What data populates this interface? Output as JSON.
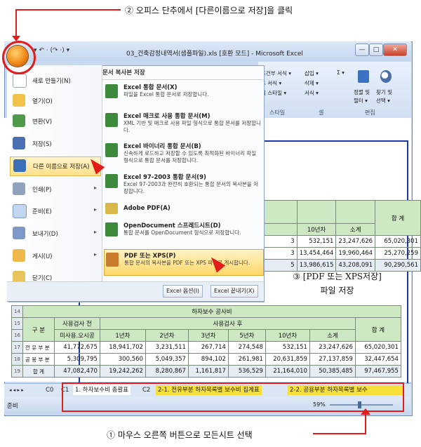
{
  "annotations": {
    "top": "② 오피스 단추에서 [다른이름으로 저장]을 클릭",
    "middle_line1": "③ [PDF 또는 XPS저장]",
    "middle_line2": "파일 저장",
    "bottom": "① 마우스 오른쪽 버튼으로 모든시트 선택"
  },
  "window": {
    "title": "03_건축감정내역서(샘플파일).xls [호환 모드] - Microsoft Excel",
    "qat": "▾ ↶ · (↷ ·) ▾",
    "controls": [
      "—",
      "□",
      "✕"
    ]
  },
  "ribbon": {
    "row1": [
      "조건부 서식 ▾",
      "삽입 ▾",
      "Σ ▾"
    ],
    "row2": [
      "표 서식 ▾",
      "삭제 ▾",
      "정렬 및",
      "찾기 및"
    ],
    "row3": [
      "셀 스타일 ▾",
      "서식 ▾",
      "필터 ▾",
      "선택 ▾"
    ],
    "groups": [
      "스타일",
      "셀",
      "편집"
    ]
  },
  "menu": {
    "items": [
      {
        "label": "새로 만들기(N)",
        "icon": "new-document-icon",
        "arrow": ""
      },
      {
        "label": "열기(O)",
        "icon": "open-folder-icon",
        "arrow": ""
      },
      {
        "label": "변환(V)",
        "icon": "convert-icon",
        "arrow": ""
      },
      {
        "label": "저장(S)",
        "icon": "save-disk-icon",
        "arrow": ""
      },
      {
        "label": "다른 이름으로 저장(A)",
        "icon": "save-as-icon",
        "arrow": "▸"
      },
      {
        "label": "인쇄(P)",
        "icon": "printer-icon",
        "arrow": "▸"
      },
      {
        "label": "준비(E)",
        "icon": "prepare-icon",
        "arrow": "▸"
      },
      {
        "label": "보내기(D)",
        "icon": "send-icon",
        "arrow": "▸"
      },
      {
        "label": "게시(U)",
        "icon": "publish-icon",
        "arrow": "▸"
      },
      {
        "label": "닫기(C)",
        "icon": "close-folder-icon",
        "arrow": ""
      }
    ],
    "sub_header": "문서 복사본 저장",
    "sub_options": [
      {
        "title": "Excel 통합 문서(X)",
        "desc": "파일을 Excel 통합 문서로 저장합니다."
      },
      {
        "title": "Excel 매크로 사용 통합 문서(M)",
        "desc": "XML 기반 및 매크로 사용 파일 형식으로 통합 문서를 저장합니다."
      },
      {
        "title": "Excel 바이너리 통합 문서(B)",
        "desc": "신속하게 로드하고 저장할 수 있도록 최적화된 바이너리 파일 형식으로 통합 문서를 저장합니다."
      },
      {
        "title": "Excel 97-2003 통합 문서(9)",
        "desc": "Excel 97-2003과 완전히 호환되는 통합 문서의 복사본을 저장합니다."
      },
      {
        "title": "Adobe PDF(A)",
        "desc": ""
      },
      {
        "title": "OpenDocument 스프레드시트(D)",
        "desc": "통합 문서를 OpenDocument 형식으로 저장합니다."
      },
      {
        "title": "PDF 또는 XPS(P)",
        "desc": "통합 문서의 복사본을 PDF 또는 XPS 파일로 게시합니다."
      }
    ],
    "options_button": "Excel 옵션(I)",
    "exit_button": "Excel 끝내기(X)"
  },
  "table_top": {
    "total_header": "합 계",
    "headers": [
      "10년차",
      "소계"
    ],
    "rows": [
      [
        "3",
        "532,151",
        "23,247,626",
        "65,020,301"
      ],
      [
        "3",
        "13,454,464",
        "19,960,464",
        "25,270,259"
      ],
      [
        "5",
        "13,986,615",
        "43,208,091",
        "90,290,561"
      ]
    ]
  },
  "table_bottom": {
    "row_numbers": [
      "14",
      "15",
      "16",
      "17",
      "18",
      "19"
    ],
    "title": "하자보수 공사비",
    "col_gubun": "구 분",
    "before": "사용검사 전",
    "after": "사용검사 후",
    "total": "합 계",
    "sub_headers": [
      "미사용.오시공",
      "1년차",
      "2년차",
      "3년차",
      "5년차",
      "10년차",
      "소계"
    ],
    "rows": [
      [
        "전 유 부 분",
        "41,772,675",
        "18,941,702",
        "3,231,511",
        "267,714",
        "274,548",
        "532,151",
        "23,247,626",
        "65,020,301"
      ],
      [
        "공 용 부 분",
        "5,309,795",
        "300,560",
        "5,049,357",
        "894,102",
        "261,981",
        "20,631,859",
        "27,137,859",
        "32,447,654"
      ],
      [
        "합 계",
        "47,082,470",
        "19,242,262",
        "8,280,867",
        "1,161,817",
        "536,529",
        "21,164,010",
        "50,385,485",
        "97,467,955"
      ]
    ]
  },
  "sheet_tabs": {
    "nav": "◂ ◂ ▸ ▸",
    "tabs": [
      "C0",
      "C1",
      "1. 하자보수비 총괄표",
      "C2",
      "2-1. 전유부분 하자목록별 보수비 집계표",
      "2-2. 공용부분 하자목록별 보수"
    ],
    "status_left": "준비",
    "zoom": "59%"
  }
}
